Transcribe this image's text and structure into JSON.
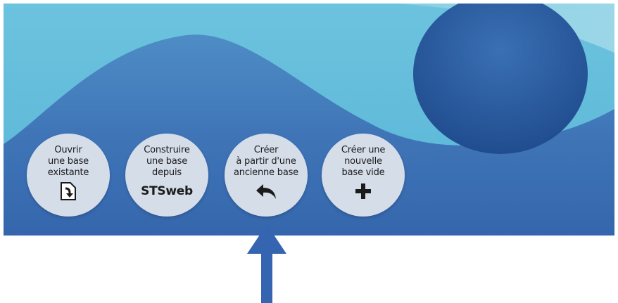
{
  "buttons": [
    {
      "label": "Ouvrir\nune base\nexistante",
      "icon": "open-file-icon"
    },
    {
      "label": "Construire\nune base\ndepuis",
      "icon_text": "STSweb"
    },
    {
      "label": "Créer\nà partir d'une\nancienne base",
      "icon": "reply-arrow-icon"
    },
    {
      "label": "Créer une\nnouvelle\nbase vide",
      "icon": "plus-icon"
    }
  ],
  "colors": {
    "light_blue": "#62bbd9",
    "mid_blue": "#3f77b8",
    "dark_blue": "#1f4d92",
    "button_bg": "#d5dde9",
    "arrow": "#3565b0"
  }
}
